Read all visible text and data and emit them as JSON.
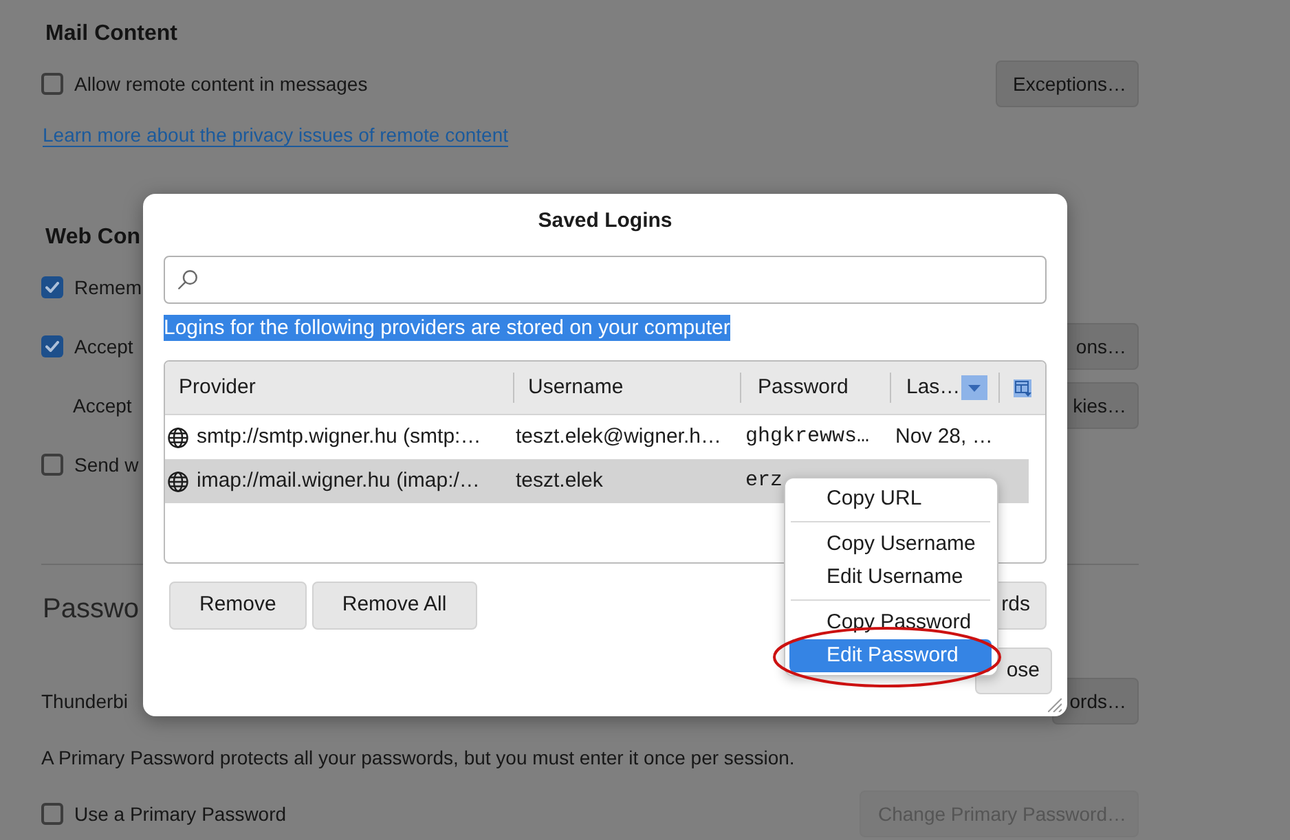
{
  "background": {
    "sections": [
      {
        "kind": "heading",
        "title": "Mail Content",
        "rows": [
          {
            "kind": "checkbox",
            "label": "Allow remote content in messages",
            "checked": false,
            "button": {
              "label": "Exceptions…",
              "disabled": false
            }
          },
          {
            "kind": "link",
            "label": "Learn more about the privacy issues of remote content"
          }
        ]
      },
      {
        "kind": "heading",
        "title": "Web Con",
        "rows": [
          {
            "kind": "checkbox",
            "label": "Remem",
            "checked": true
          },
          {
            "kind": "checkbox",
            "label": "Accept",
            "checked": true,
            "button": {
              "label": "ons…",
              "disabled": false
            }
          },
          {
            "kind": "label",
            "label": "Accept",
            "button": {
              "label": "kies…",
              "disabled": false
            }
          },
          {
            "kind": "checkbox",
            "label": "Send w",
            "checked": false
          }
        ]
      },
      {
        "kind": "section",
        "title": "Passwo",
        "rows": [
          {
            "kind": "text",
            "label": "Thunderbi",
            "button": {
              "label": "ords…",
              "disabled": false
            }
          },
          {
            "kind": "text",
            "label": "A Primary Password protects all your passwords, but you must enter it once per session."
          },
          {
            "kind": "checkbox",
            "label": "Use a Primary Password",
            "checked": false,
            "button": {
              "label": "Change Primary Password…",
              "disabled": true
            }
          }
        ]
      }
    ]
  },
  "dialog": {
    "title": "Saved Logins",
    "notice": {
      "text": "Logins for the following providers are stored on your computer",
      "selected": true
    },
    "table": {
      "columns": [
        {
          "label": "Provider",
          "sorted": false
        },
        {
          "label": "Username",
          "sorted": false
        },
        {
          "label": "Password",
          "sorted": false
        },
        {
          "label": "Las…",
          "sorted": true
        }
      ],
      "rows": [
        {
          "cells": [
            "smtp://smtp.wigner.hu (smtp:…",
            "teszt.elek@wigner.h…",
            "ghgkrewws…",
            "Nov 28, …"
          ],
          "selected": false
        },
        {
          "cells": [
            "imap://mail.wigner.hu (imap:/…",
            "teszt.elek",
            "erz"
          ],
          "selected": true
        }
      ]
    },
    "buttons": [
      {
        "label": "Remove"
      },
      {
        "label": "Remove All"
      }
    ],
    "end_button": {
      "label": "rds"
    },
    "footer_button": {
      "label": "ose"
    }
  },
  "context_menu": {
    "items": [
      {
        "kind": "item",
        "label": "Copy URL",
        "selected": false,
        "circled": false
      },
      {
        "kind": "separator"
      },
      {
        "kind": "item",
        "label": "Copy Username",
        "selected": false,
        "circled": false
      },
      {
        "kind": "item",
        "label": "Edit Username",
        "selected": false,
        "circled": false
      },
      {
        "kind": "separator"
      },
      {
        "kind": "item",
        "label": "Copy Password",
        "selected": false,
        "circled": false
      },
      {
        "kind": "item",
        "label": "Edit Password",
        "selected": true,
        "circled": true
      }
    ]
  }
}
